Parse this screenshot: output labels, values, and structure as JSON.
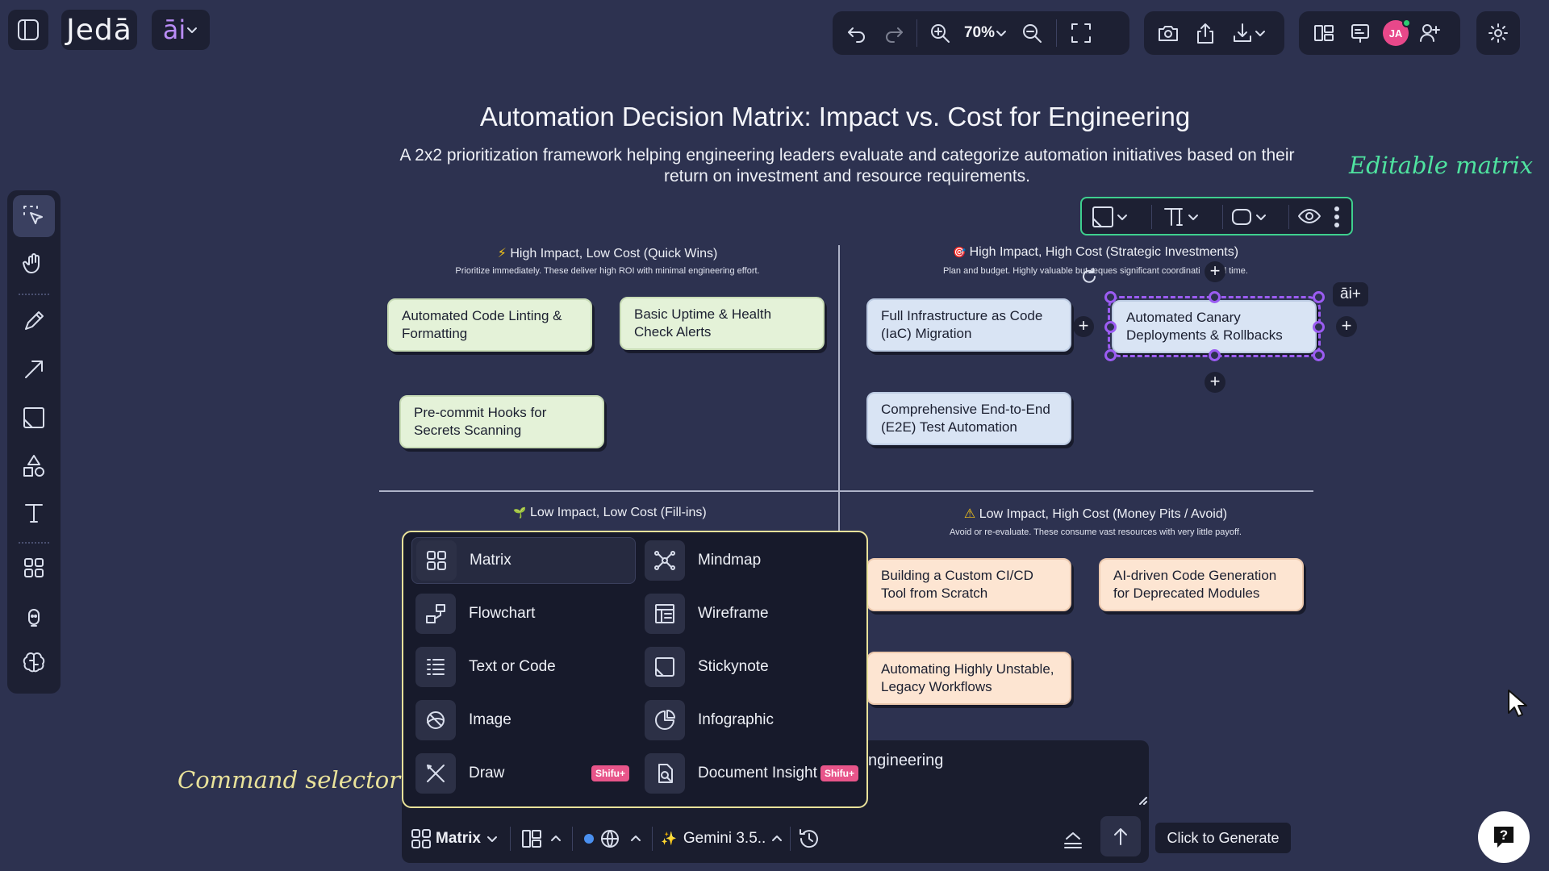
{
  "app": {
    "logo": "Jedā",
    "ai_label": "āi"
  },
  "toolbar": {
    "zoom": "70%",
    "avatar_initials": "JA"
  },
  "canvas": {
    "title": "Automation Decision Matrix: Impact vs. Cost for Engineering",
    "subtitle": "A 2x2 prioritization framework helping engineering leaders evaluate and categorize automation initiatives based on their return on investment and resource requirements.",
    "label_editable": "Editable matrix",
    "label_command": "Command selector",
    "quadrants": [
      {
        "icon": "⚡",
        "heading": "High Impact, Low Cost (Quick Wins)",
        "sub": "Prioritize immediately. These deliver high ROI with minimal engineering effort.",
        "notes": [
          "Automated Code Linting & Formatting",
          "Basic Uptime & Health Check Alerts",
          "Pre-commit Hooks for Secrets Scanning"
        ]
      },
      {
        "icon": "🎯",
        "heading": "High Impact, High Cost (Strategic Investments)",
        "sub_left": "Plan and budget. Highly valuable but req",
        "sub_right": "ues significant coordinati",
        "sub_end": "l time.",
        "notes": [
          "Full Infrastructure as Code (IaC) Migration",
          "Automated Canary Deployments & Rollbacks",
          "Comprehensive End-to-End (E2E) Test Automation"
        ]
      },
      {
        "icon": "🌱",
        "heading": "Low Impact, Low Cost (Fill-ins)",
        "notes": []
      },
      {
        "icon": "⚠",
        "heading": "Low Impact, High Cost (Money Pits / Avoid)",
        "sub": "Avoid or re-evaluate. These consume vast resources with very little payoff.",
        "notes": [
          "Building a Custom CI/CD Tool from Scratch",
          "AI-driven Code Generation for Deprecated Modules",
          "Automating Highly Unstable, Legacy Workflows"
        ]
      }
    ],
    "ai_plus": "āi+"
  },
  "command_selector": {
    "items": [
      {
        "label": "Matrix",
        "icon": "matrix-icon"
      },
      {
        "label": "Mindmap",
        "icon": "mindmap-icon"
      },
      {
        "label": "Flowchart",
        "icon": "flowchart-icon"
      },
      {
        "label": "Wireframe",
        "icon": "wireframe-icon"
      },
      {
        "label": "Text or Code",
        "icon": "text-code-icon"
      },
      {
        "label": "Stickynote",
        "icon": "stickynote-icon"
      },
      {
        "label": "Image",
        "icon": "image-icon"
      },
      {
        "label": "Infographic",
        "icon": "infographic-icon"
      },
      {
        "label": "Draw",
        "icon": "draw-icon",
        "badge": "Shifu+"
      },
      {
        "label": "Document Insight",
        "icon": "document-insight-icon",
        "badge": "Shifu+"
      }
    ]
  },
  "prompt": {
    "text": "ngineering",
    "mode": "Matrix",
    "model": "Gemini 3.5..",
    "generate_tooltip": "Click to Generate"
  },
  "colors": {
    "background": "#2d3250",
    "panel": "#1d2033",
    "accent": "#9b5cf2",
    "green_label": "#4fe3a0",
    "yellow_label": "#e9e29a"
  }
}
